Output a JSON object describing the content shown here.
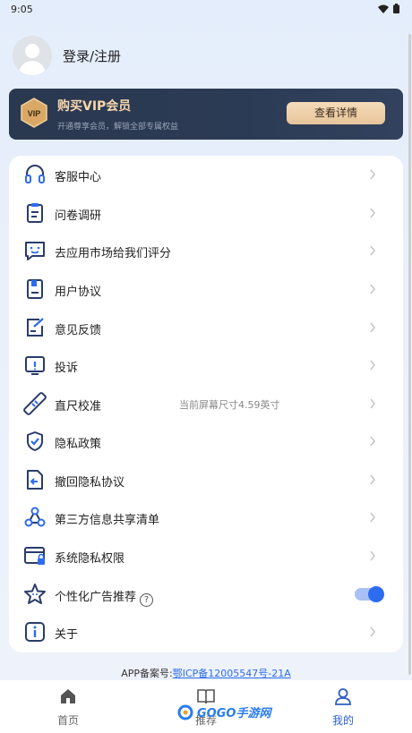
{
  "status": {
    "time": "9:05"
  },
  "profile": {
    "login_label": "登录/注册"
  },
  "vip": {
    "badge": "VIP",
    "title": "购买VIP会员",
    "subtitle": "开通尊享会员，解锁全部专属权益",
    "button": "查看详情"
  },
  "menu": [
    {
      "label": "客服中心",
      "icon": "headset-icon"
    },
    {
      "label": "问卷调研",
      "icon": "clipboard-icon"
    },
    {
      "label": "去应用市场给我们评分",
      "icon": "smile-chat-icon"
    },
    {
      "label": "用户协议",
      "icon": "document-icon"
    },
    {
      "label": "意见反馈",
      "icon": "edit-note-icon"
    },
    {
      "label": "投诉",
      "icon": "report-icon"
    },
    {
      "label": "直尺校准",
      "icon": "ruler-icon",
      "extra": "当前屏幕尺寸4.59英寸"
    },
    {
      "label": "隐私政策",
      "icon": "shield-check-icon"
    },
    {
      "label": "撤回隐私协议",
      "icon": "revoke-document-icon"
    },
    {
      "label": "第三方信息共享清单",
      "icon": "share-nodes-icon"
    },
    {
      "label": "系统隐私权限",
      "icon": "window-lock-icon"
    },
    {
      "label": "个性化广告推荐",
      "icon": "star-face-icon",
      "help": "?",
      "toggle_on": true
    },
    {
      "label": "关于",
      "icon": "info-icon"
    }
  ],
  "icp": {
    "prefix": "APP备案号:",
    "link": "鄂ICP备12005547号-21A"
  },
  "tabs": [
    {
      "label": "首页",
      "icon": "home-icon"
    },
    {
      "label": "推荐",
      "icon": "book-icon"
    },
    {
      "label": "我的",
      "icon": "user-icon",
      "active": true
    }
  ],
  "watermark": {
    "text": "GOGO手游网"
  },
  "colors": {
    "accent": "#2d6cf0",
    "vip_gold": "#f6d7ad",
    "vip_bg": "#2a3850"
  }
}
